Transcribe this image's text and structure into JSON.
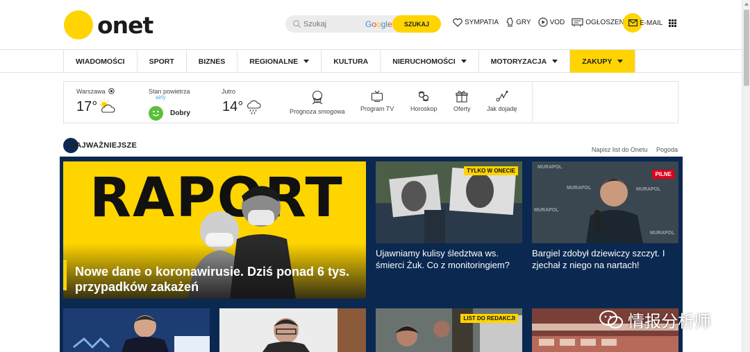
{
  "header": {
    "logo_text": "onet",
    "search_placeholder": "Szukaj",
    "search_provider": [
      "G",
      "o",
      "o",
      "g",
      "l",
      "e"
    ],
    "search_button": "SZUKAJ",
    "links": [
      {
        "label": "SYMPATIA",
        "icon": "heart-icon"
      },
      {
        "label": "GRY",
        "icon": "chess-knight-icon"
      },
      {
        "label": "VOD",
        "icon": "play-circle-icon"
      },
      {
        "label": "OGŁOSZENIA",
        "icon": "ads-board-icon"
      }
    ],
    "email_label": "E-MAIL"
  },
  "nav": {
    "items": [
      {
        "label": "WIADOMOŚCI",
        "dropdown": false
      },
      {
        "label": "SPORT",
        "dropdown": false
      },
      {
        "label": "BIZNES",
        "dropdown": false
      },
      {
        "label": "REGIONALNE",
        "dropdown": true
      },
      {
        "label": "KULTURA",
        "dropdown": false
      },
      {
        "label": "NIERUCHOMOŚCI",
        "dropdown": true
      },
      {
        "label": "MOTORYZACJA",
        "dropdown": true
      },
      {
        "label": "ZAKUPY",
        "dropdown": true,
        "active": true
      }
    ]
  },
  "widgets": {
    "city": "Warszawa",
    "temp_today": "17°",
    "air_label": "Stan powietrza",
    "air_provider": "airly",
    "air_status": "Dobry",
    "tomorrow_label": "Jutro",
    "temp_tomorrow": "14°",
    "tools": [
      {
        "label": "Prognoza smogowa",
        "icon": "smog-mask-icon"
      },
      {
        "label": "Program TV",
        "icon": "tv-icon"
      },
      {
        "label": "Horoskop",
        "icon": "zodiac-icon"
      },
      {
        "label": "Oferty",
        "icon": "gift-icon"
      },
      {
        "label": "Jak dojadę",
        "icon": "route-icon"
      }
    ]
  },
  "section": {
    "title": "NAJWAŻNIEJSZE",
    "links": [
      "Napisz list do Onetu",
      "Pogoda"
    ]
  },
  "hero": {
    "image_word": "RAPORT",
    "title": "Nowe dane o koronawirusie. Dziś ponad 6 tys. przypadków zakażeń"
  },
  "cards": [
    {
      "tag": "TYLKO W ONECIE",
      "tag_style": "yellow",
      "title": "Ujawniamy kulisy śledztwa ws. śmierci Żuk. Co z monitoringiem?"
    },
    {
      "tag": "PILNE",
      "tag_style": "red",
      "title": "Bargiel zdobył dziewiczy szczyt. I zjechał z niego na nartach!"
    },
    {
      "tag": "",
      "tag_style": "",
      "title": ""
    },
    {
      "tag": "",
      "tag_style": "",
      "title": ""
    },
    {
      "tag": "LIST DO REDAKCJI",
      "tag_style": "yellow",
      "title": ""
    },
    {
      "tag": "",
      "tag_style": "",
      "title": ""
    }
  ],
  "sponsor_logo_text": "MURAPOL",
  "watermark": "情报分析师",
  "colors": {
    "brand_yellow": "#ffd400",
    "panel_navy": "#0a2850",
    "alert_red": "#e2001a"
  }
}
